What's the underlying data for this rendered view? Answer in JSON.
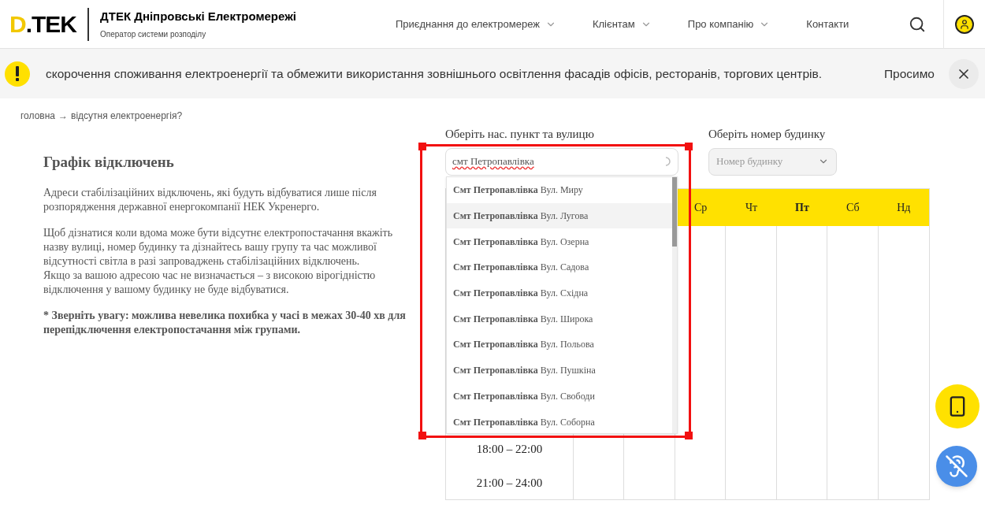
{
  "header": {
    "logo": "D.TEK",
    "brand_title": "ДТЕК Дніпровські Електромережі",
    "brand_subtitle": "Оператор системи розподілу",
    "nav": [
      {
        "label": "Приєднання до електромереж",
        "has_menu": true
      },
      {
        "label": "Клієнтам",
        "has_menu": true
      },
      {
        "label": "Про компанію",
        "has_menu": true
      },
      {
        "label": "Контакти",
        "has_menu": false
      }
    ]
  },
  "alert": {
    "text": "скорочення споживання електроенергії та обмежити використання зовнішнього освітлення фасадів офісів, ресторанів, торгових центрів.",
    "trailing": "Просимо"
  },
  "breadcrumb": {
    "home": "головна",
    "separator": "→",
    "current": "відсутня електроенергія?"
  },
  "intro": {
    "title": "Графік відключень",
    "paragraphs": [
      "Адреси стабілізаційних відключень, які будуть відбуватися лише після розпорядження державної енергокомпанії НЕК Укренерго.",
      "Щоб дізнатися коли вдома може бути відсутнє електропостачання вкажіть назву вулиці, номер будинку та дізнайтесь вашу групу та час можливої відсутності світла в разі запроваджень стабілізаційних відключень.\nЯкщо за вашою адресою час не визначається – з високою вірогідністю відключення у вашому будинку не буде відбуватися."
    ],
    "note": "* Зверніть увагу: можлива невелика похибка у часі в межах 30-40 хв для перепідключення електропостачання між групами."
  },
  "street_select": {
    "label": "Оберіть нас. пункт та вулицю",
    "value": "смт Петропавлівка",
    "options": [
      {
        "town": "Смт Петропавлівка",
        "street": "Вул. Миру",
        "selected": false
      },
      {
        "town": "Смт Петропавлівка",
        "street": "Вул. Лугова",
        "selected": true
      },
      {
        "town": "Смт Петропавлівка",
        "street": "Вул. Озерна",
        "selected": false
      },
      {
        "town": "Смт Петропавлівка",
        "street": "Вул. Садова",
        "selected": false
      },
      {
        "town": "Смт Петропавлівка",
        "street": "Вул. Східна",
        "selected": false
      },
      {
        "town": "Смт Петропавлівка",
        "street": "Вул. Широка",
        "selected": false
      },
      {
        "town": "Смт Петропавлівка",
        "street": "Вул. Польова",
        "selected": false
      },
      {
        "town": "Смт Петропавлівка",
        "street": "Вул. Пушкіна",
        "selected": false
      },
      {
        "town": "Смт Петропавлівка",
        "street": "Вул. Свободи",
        "selected": false
      },
      {
        "town": "Смт Петропавлівка",
        "street": "Вул. Соборна",
        "selected": false
      }
    ]
  },
  "house_select": {
    "label": "Оберіть номер будинку",
    "placeholder": "Номер будинку",
    "disabled": true
  },
  "schedule": {
    "days": [
      {
        "label": "Ср",
        "selected": false
      },
      {
        "label": "Чт",
        "selected": false
      },
      {
        "label": "Пт",
        "selected": true
      },
      {
        "label": "Сб",
        "selected": false
      },
      {
        "label": "Нд",
        "selected": false
      }
    ],
    "times": [
      "18:00 – 22:00",
      "21:00 – 24:00"
    ]
  }
}
